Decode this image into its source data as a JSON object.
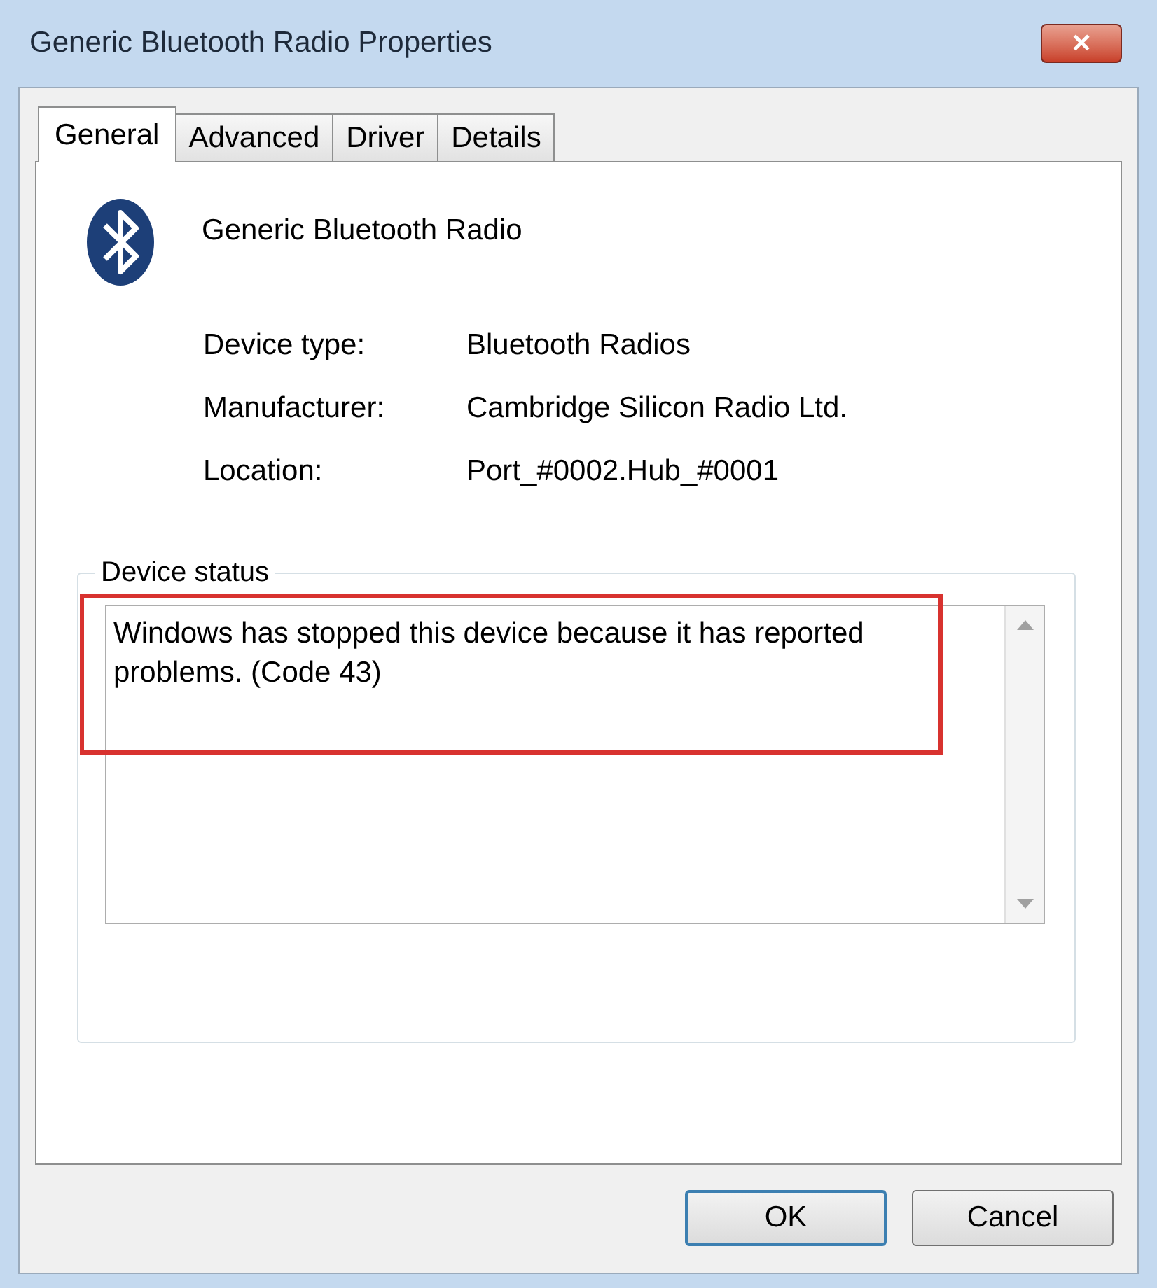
{
  "window": {
    "title": "Generic Bluetooth Radio Properties",
    "close": "✕"
  },
  "tabs": [
    {
      "label": "General",
      "selected": true
    },
    {
      "label": "Advanced",
      "selected": false
    },
    {
      "label": "Driver",
      "selected": false
    },
    {
      "label": "Details",
      "selected": false
    }
  ],
  "device_name": "Generic Bluetooth Radio",
  "properties": [
    {
      "label": "Device type:",
      "value": "Bluetooth Radios"
    },
    {
      "label": "Manufacturer:",
      "value": "Cambridge Silicon Radio Ltd."
    },
    {
      "label": "Location:",
      "value": "Port_#0002.Hub_#0001"
    }
  ],
  "device_status": {
    "label": "Device status",
    "text": "Windows has stopped this device because it has reported problems. (Code 43)"
  },
  "buttons": [
    "OK",
    "Cancel"
  ]
}
